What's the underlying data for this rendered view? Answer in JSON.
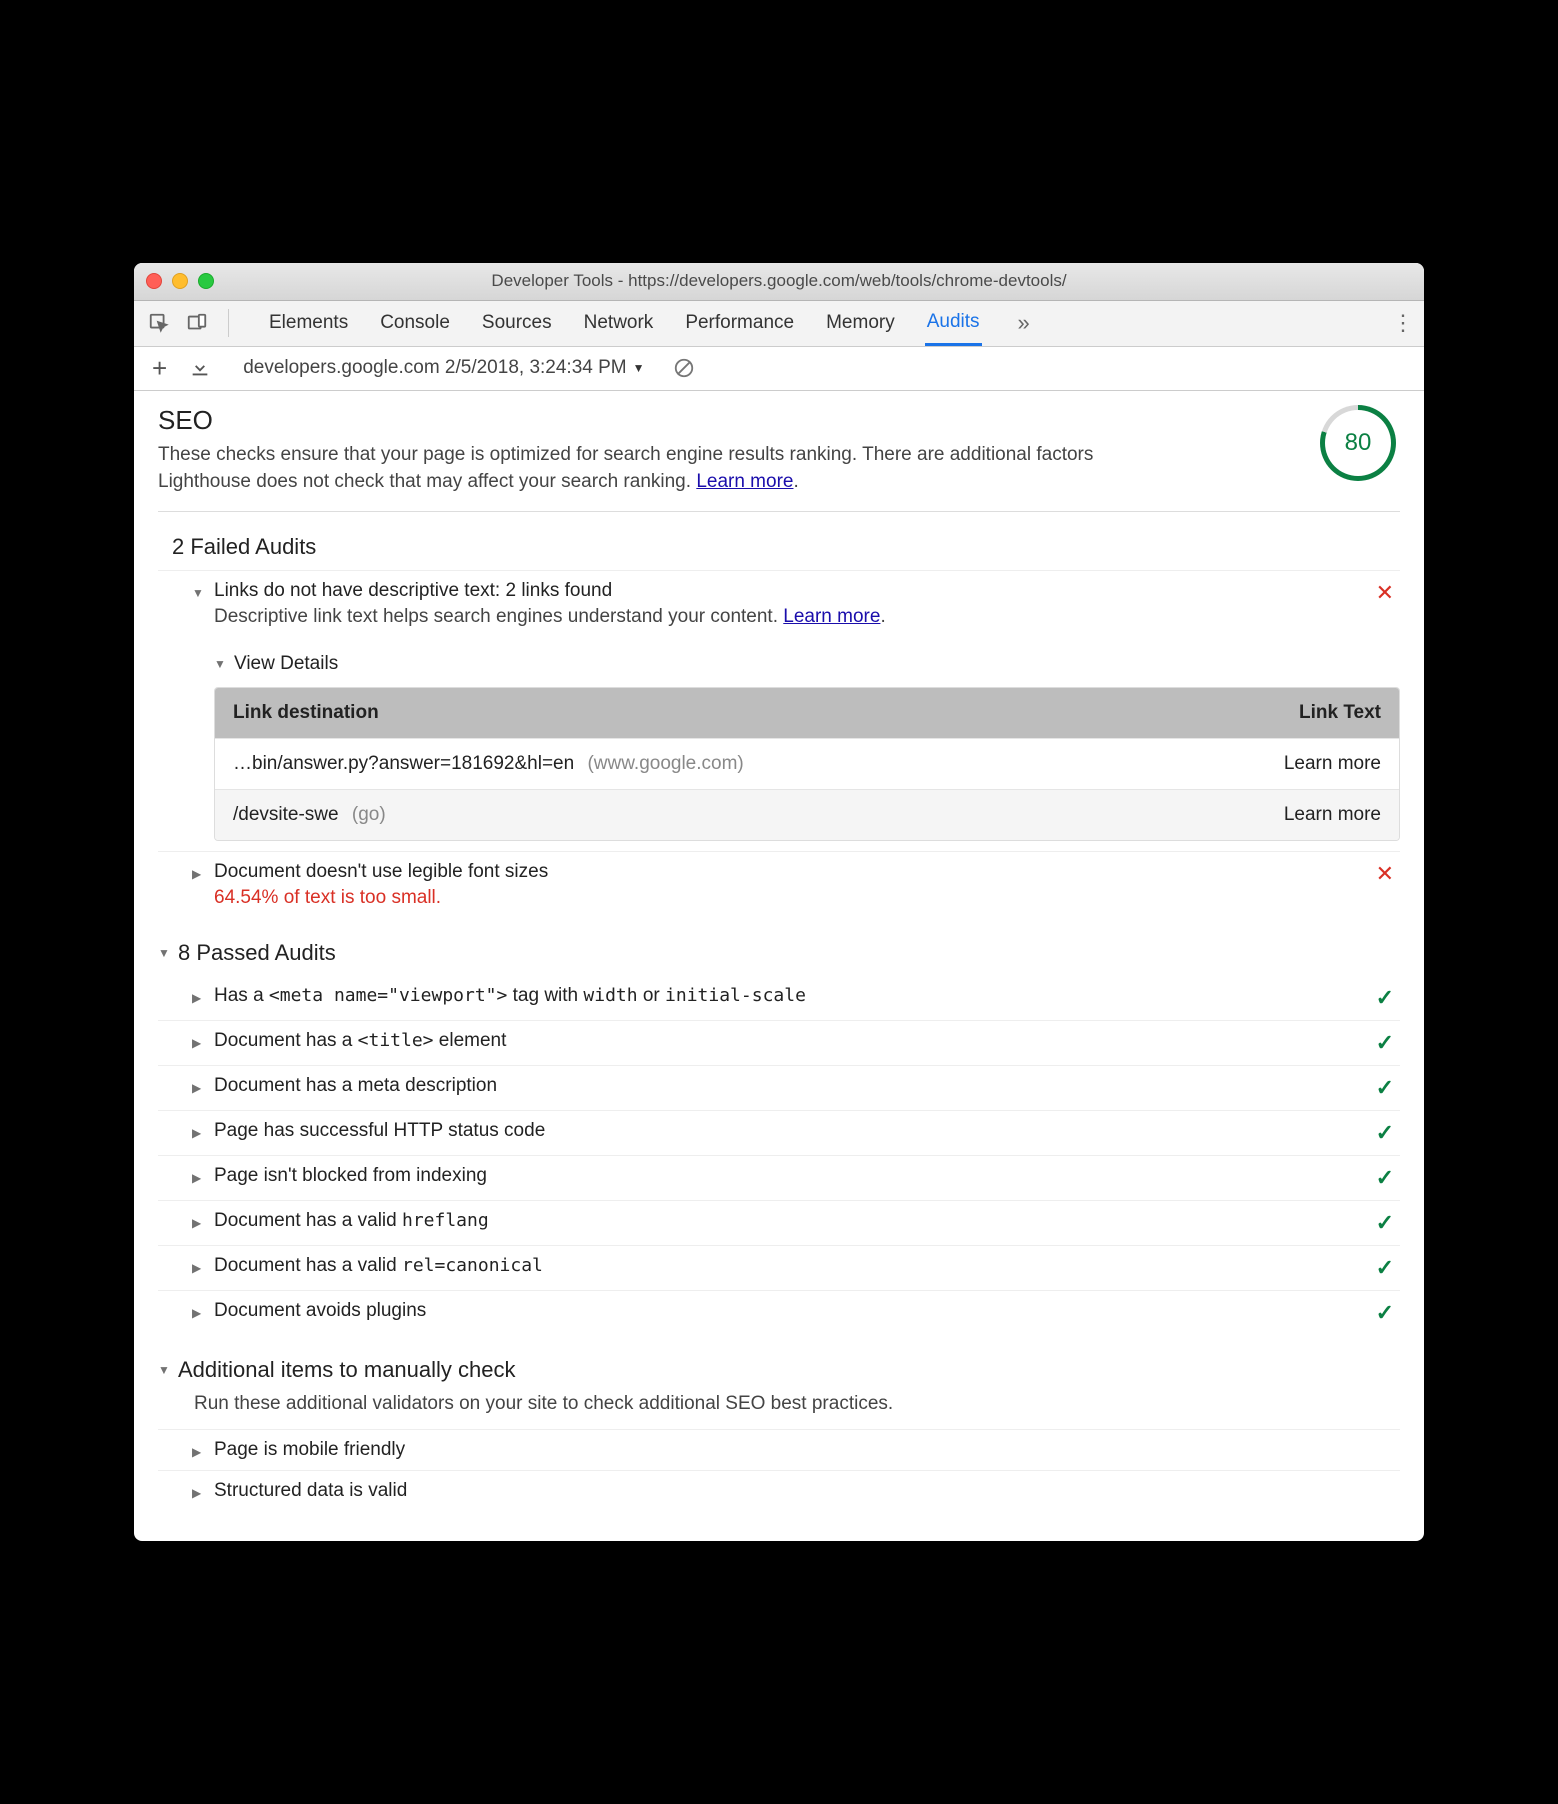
{
  "window": {
    "title": "Developer Tools - https://developers.google.com/web/tools/chrome-devtools/"
  },
  "tabs": {
    "items": [
      "Elements",
      "Console",
      "Sources",
      "Network",
      "Performance",
      "Memory",
      "Audits"
    ],
    "active": "Audits"
  },
  "report_selector": "developers.google.com 2/5/2018, 3:24:34 PM",
  "seo": {
    "heading": "SEO",
    "description": "These checks ensure that your page is optimized for search engine results ranking. There are additional factors Lighthouse does not check that may affect your search ranking. ",
    "learn_more": "Learn more",
    "score": "80"
  },
  "failed": {
    "heading": "2 Failed Audits",
    "audit1": {
      "title": "Links do not have descriptive text: 2 links found",
      "sub": "Descriptive link text helps search engines understand your content. ",
      "learn": "Learn more",
      "view_details": "View Details",
      "col_dest": "Link destination",
      "col_text": "Link Text",
      "rows": [
        {
          "dest": "…bin/answer.py?answer=181692&hl=en",
          "host": "(www.google.com)",
          "text": "Learn more"
        },
        {
          "dest": "/devsite-swe",
          "host": "(go)",
          "text": "Learn more"
        }
      ]
    },
    "audit2": {
      "title": "Document doesn't use legible font sizes",
      "err": "64.54% of text is too small."
    }
  },
  "passed": {
    "heading": "8 Passed Audits",
    "items": [
      {
        "pre": "Has a ",
        "code": "<meta name=\"viewport\">",
        "mid": " tag with ",
        "code2": "width",
        "mid2": " or ",
        "code3": "initial-scale"
      },
      {
        "pre": "Document has a ",
        "code": "<title>",
        "mid": " element"
      },
      {
        "pre": "Document has a meta description"
      },
      {
        "pre": "Page has successful HTTP status code"
      },
      {
        "pre": "Page isn't blocked from indexing"
      },
      {
        "pre": "Document has a valid ",
        "code": "hreflang"
      },
      {
        "pre": "Document has a valid ",
        "code": "rel=canonical"
      },
      {
        "pre": "Document avoids plugins"
      }
    ]
  },
  "manual": {
    "heading": "Additional items to manually check",
    "desc": "Run these additional validators on your site to check additional SEO best practices.",
    "items": [
      "Page is mobile friendly",
      "Structured data is valid"
    ]
  }
}
